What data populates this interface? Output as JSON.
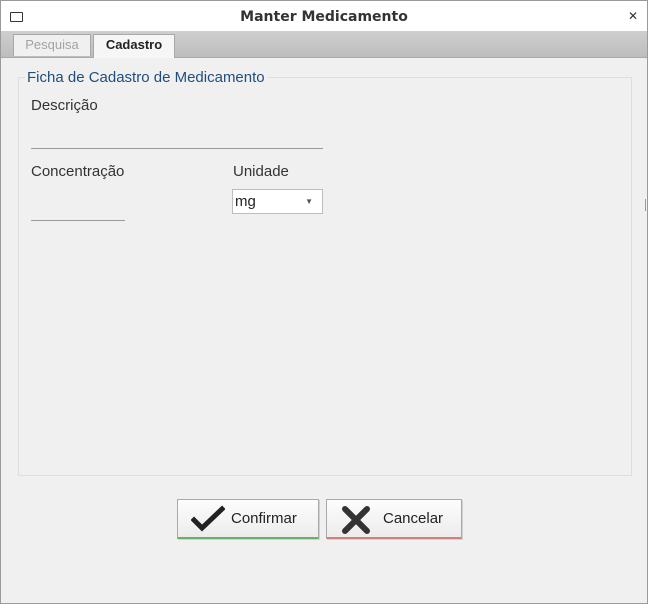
{
  "window": {
    "title": "Manter Medicamento"
  },
  "tabs": [
    {
      "label": "Pesquisa",
      "active": false
    },
    {
      "label": "Cadastro",
      "active": true
    }
  ],
  "form": {
    "legend": "Ficha de Cadastro de Medicamento",
    "descricao": {
      "label": "Descrição",
      "value": ""
    },
    "concentracao": {
      "label": "Concentração",
      "value": ""
    },
    "unidade": {
      "label": "Unidade",
      "selected": "mg"
    }
  },
  "buttons": {
    "confirm": {
      "label": "Confirmar",
      "icon": "check-icon",
      "accent": "#6ab06a"
    },
    "cancel": {
      "label": "Cancelar",
      "icon": "x-icon",
      "accent": "#d08080"
    }
  },
  "colors": {
    "legend": "#1f4e7c",
    "window_bg": "#f0f0f0"
  }
}
